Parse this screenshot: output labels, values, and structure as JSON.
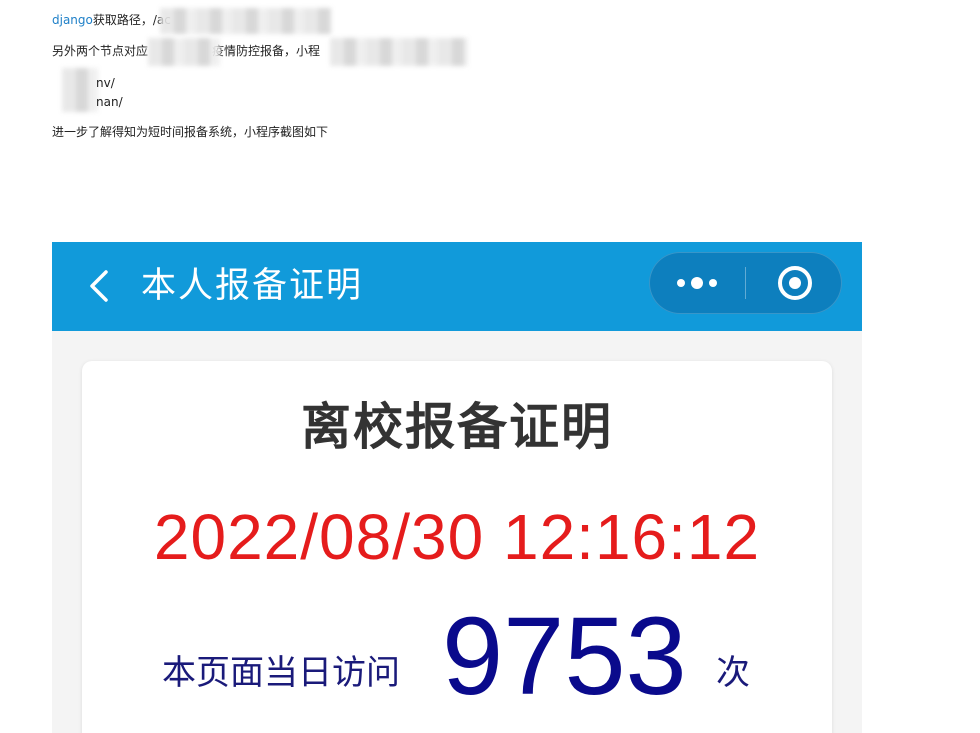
{
  "article": {
    "line1_link": "django",
    "line1_text": "获取路径，/ac",
    "line2_part1": "另外两个节点对应",
    "line2_part2": "疫情防控报备，小程",
    "line3_text": "nv/",
    "line4_text": "nan/",
    "line5_text": "进一步了解得知为短时间报备系统，小程序截图如下"
  },
  "phone": {
    "nav_title": "本人报备证明",
    "back_icon": "chevron-left-icon",
    "more_icon": "more-dots-icon",
    "close_icon": "target-circle-icon",
    "nav_color": "#119ada",
    "card": {
      "title": "离校报备证明",
      "datetime": "2022/08/30 12:16:12",
      "visit_label": "本页面当日访问",
      "visit_count": "9753",
      "visit_unit": "次",
      "datetime_color": "#e51c1c",
      "count_color": "#0a0a8c"
    }
  }
}
